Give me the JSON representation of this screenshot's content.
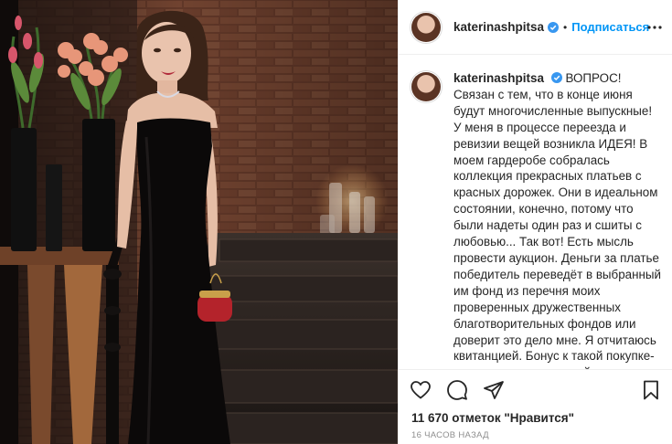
{
  "photo": {
    "alt": ""
  },
  "header": {
    "username": "katerinashpitsa",
    "separator": "•",
    "follow_label": "Подписаться"
  },
  "caption": {
    "username": "katerinashpitsa",
    "text": "ВОПРОС! Связан с тем, что в конце июня будут многочисленные выпускные! У меня в процессе переезда и ревизии вещей возникла ИДЕЯ! В моем гардеробе собралась коллекция прекрасных платьев с красных дорожек. Они в идеальном состоянии, конечно, потому что были надеты один раз и сшиты с любовью... Так вот! Есть мысль провести аукцион. Деньги за платье победитель переведёт в выбранный им фонд из перечня моих проверенных дружественных благотворительных фондов или доверит это дело мне. Я отчитаюсь квитанцией. Бонус к такой покупке- личная встреча со мной на примерке 😊 Откликнитесь."
  },
  "actions": {
    "likes": "11 670 отметок \"Нравится\"",
    "time": "16 часов назад"
  },
  "colors": {
    "accent": "#0095f6",
    "verified": "#3897f0",
    "text": "#262626",
    "muted": "#8e8e8e",
    "border": "#efefef"
  },
  "icons": [
    "heart-icon",
    "comment-icon",
    "share-icon",
    "bookmark-icon",
    "more-icon",
    "verified-badge-icon"
  ]
}
